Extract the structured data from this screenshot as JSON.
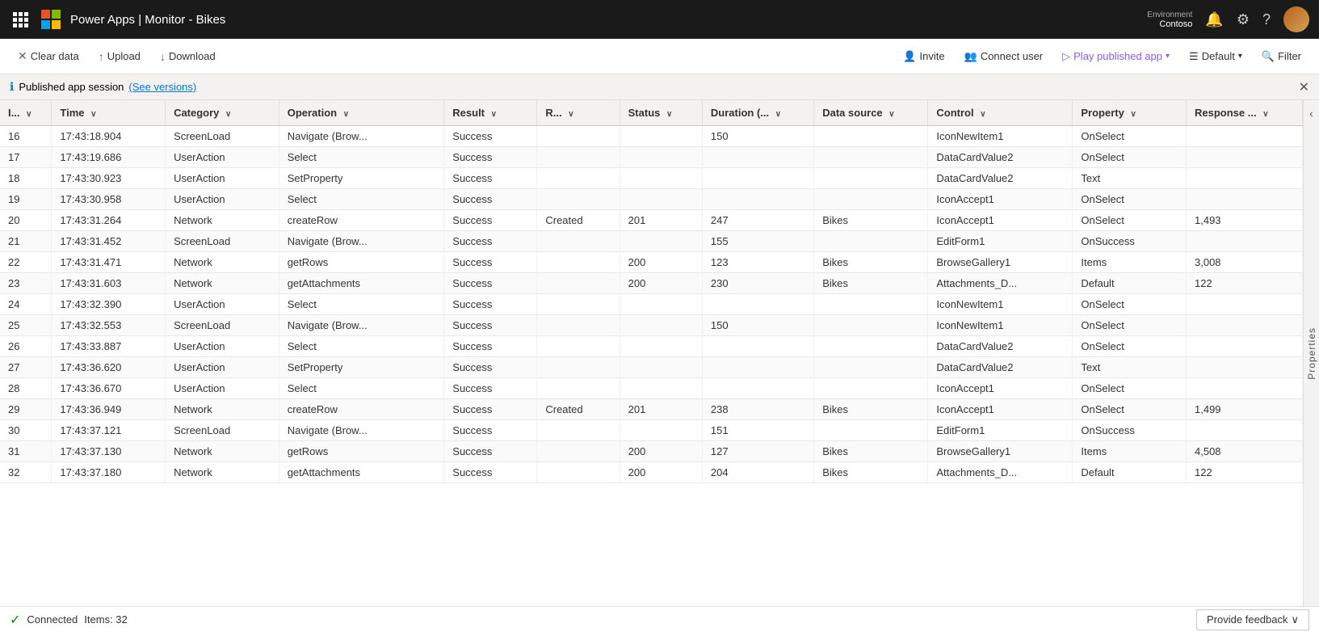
{
  "app": {
    "title": "Power Apps | Monitor - Bikes",
    "env_label": "Environment",
    "env_name": "Contoso"
  },
  "toolbar": {
    "clear_data": "Clear data",
    "upload": "Upload",
    "download": "Download",
    "invite": "Invite",
    "connect_user": "Connect user",
    "play_published_app": "Play published app",
    "default": "Default",
    "filter": "Filter"
  },
  "info_bar": {
    "text": "Published app session",
    "link_text": "(See versions)"
  },
  "columns": [
    {
      "label": "I...",
      "key": "id"
    },
    {
      "label": "Time",
      "key": "time"
    },
    {
      "label": "Category",
      "key": "category"
    },
    {
      "label": "Operation",
      "key": "operation"
    },
    {
      "label": "Result",
      "key": "result"
    },
    {
      "label": "R...",
      "key": "r"
    },
    {
      "label": "Status",
      "key": "status"
    },
    {
      "label": "Duration (...",
      "key": "duration"
    },
    {
      "label": "Data source",
      "key": "datasource"
    },
    {
      "label": "Control",
      "key": "control"
    },
    {
      "label": "Property",
      "key": "property"
    },
    {
      "label": "Response ...",
      "key": "response"
    }
  ],
  "rows": [
    {
      "id": "16",
      "time": "17:43:18.904",
      "category": "ScreenLoad",
      "operation": "Navigate (Brow...",
      "result": "Success",
      "r": "",
      "status": "",
      "duration": "150",
      "datasource": "",
      "control": "IconNewItem1",
      "property": "OnSelect",
      "response": ""
    },
    {
      "id": "17",
      "time": "17:43:19.686",
      "category": "UserAction",
      "operation": "Select",
      "result": "Success",
      "r": "",
      "status": "",
      "duration": "",
      "datasource": "",
      "control": "DataCardValue2",
      "property": "OnSelect",
      "response": ""
    },
    {
      "id": "18",
      "time": "17:43:30.923",
      "category": "UserAction",
      "operation": "SetProperty",
      "result": "Success",
      "r": "",
      "status": "",
      "duration": "",
      "datasource": "",
      "control": "DataCardValue2",
      "property": "Text",
      "response": ""
    },
    {
      "id": "19",
      "time": "17:43:30.958",
      "category": "UserAction",
      "operation": "Select",
      "result": "Success",
      "r": "",
      "status": "",
      "duration": "",
      "datasource": "",
      "control": "IconAccept1",
      "property": "OnSelect",
      "response": ""
    },
    {
      "id": "20",
      "time": "17:43:31.264",
      "category": "Network",
      "operation": "createRow",
      "result": "Success",
      "r": "Created",
      "status": "201",
      "duration": "247",
      "datasource": "Bikes",
      "control": "IconAccept1",
      "property": "OnSelect",
      "response": "1,493"
    },
    {
      "id": "21",
      "time": "17:43:31.452",
      "category": "ScreenLoad",
      "operation": "Navigate (Brow...",
      "result": "Success",
      "r": "",
      "status": "",
      "duration": "155",
      "datasource": "",
      "control": "EditForm1",
      "property": "OnSuccess",
      "response": ""
    },
    {
      "id": "22",
      "time": "17:43:31.471",
      "category": "Network",
      "operation": "getRows",
      "result": "Success",
      "r": "",
      "status": "200",
      "duration": "123",
      "datasource": "Bikes",
      "control": "BrowseGallery1",
      "property": "Items",
      "response": "3,008"
    },
    {
      "id": "23",
      "time": "17:43:31.603",
      "category": "Network",
      "operation": "getAttachments",
      "result": "Success",
      "r": "",
      "status": "200",
      "duration": "230",
      "datasource": "Bikes",
      "control": "Attachments_D...",
      "property": "Default",
      "response": "122"
    },
    {
      "id": "24",
      "time": "17:43:32.390",
      "category": "UserAction",
      "operation": "Select",
      "result": "Success",
      "r": "",
      "status": "",
      "duration": "",
      "datasource": "",
      "control": "IconNewItem1",
      "property": "OnSelect",
      "response": ""
    },
    {
      "id": "25",
      "time": "17:43:32.553",
      "category": "ScreenLoad",
      "operation": "Navigate (Brow...",
      "result": "Success",
      "r": "",
      "status": "",
      "duration": "150",
      "datasource": "",
      "control": "IconNewItem1",
      "property": "OnSelect",
      "response": ""
    },
    {
      "id": "26",
      "time": "17:43:33.887",
      "category": "UserAction",
      "operation": "Select",
      "result": "Success",
      "r": "",
      "status": "",
      "duration": "",
      "datasource": "",
      "control": "DataCardValue2",
      "property": "OnSelect",
      "response": ""
    },
    {
      "id": "27",
      "time": "17:43:36.620",
      "category": "UserAction",
      "operation": "SetProperty",
      "result": "Success",
      "r": "",
      "status": "",
      "duration": "",
      "datasource": "",
      "control": "DataCardValue2",
      "property": "Text",
      "response": ""
    },
    {
      "id": "28",
      "time": "17:43:36.670",
      "category": "UserAction",
      "operation": "Select",
      "result": "Success",
      "r": "",
      "status": "",
      "duration": "",
      "datasource": "",
      "control": "IconAccept1",
      "property": "OnSelect",
      "response": ""
    },
    {
      "id": "29",
      "time": "17:43:36.949",
      "category": "Network",
      "operation": "createRow",
      "result": "Success",
      "r": "Created",
      "status": "201",
      "duration": "238",
      "datasource": "Bikes",
      "control": "IconAccept1",
      "property": "OnSelect",
      "response": "1,499"
    },
    {
      "id": "30",
      "time": "17:43:37.121",
      "category": "ScreenLoad",
      "operation": "Navigate (Brow...",
      "result": "Success",
      "r": "",
      "status": "",
      "duration": "151",
      "datasource": "",
      "control": "EditForm1",
      "property": "OnSuccess",
      "response": ""
    },
    {
      "id": "31",
      "time": "17:43:37.130",
      "category": "Network",
      "operation": "getRows",
      "result": "Success",
      "r": "",
      "status": "200",
      "duration": "127",
      "datasource": "Bikes",
      "control": "BrowseGallery1",
      "property": "Items",
      "response": "4,508"
    },
    {
      "id": "32",
      "time": "17:43:37.180",
      "category": "Network",
      "operation": "getAttachments",
      "result": "Success",
      "r": "",
      "status": "200",
      "duration": "204",
      "datasource": "Bikes",
      "control": "Attachments_D...",
      "property": "Default",
      "response": "122"
    }
  ],
  "status_bar": {
    "connected": "Connected",
    "items": "Items: 32",
    "feedback": "Provide feedback"
  },
  "side_panel": {
    "label": "Properties"
  }
}
